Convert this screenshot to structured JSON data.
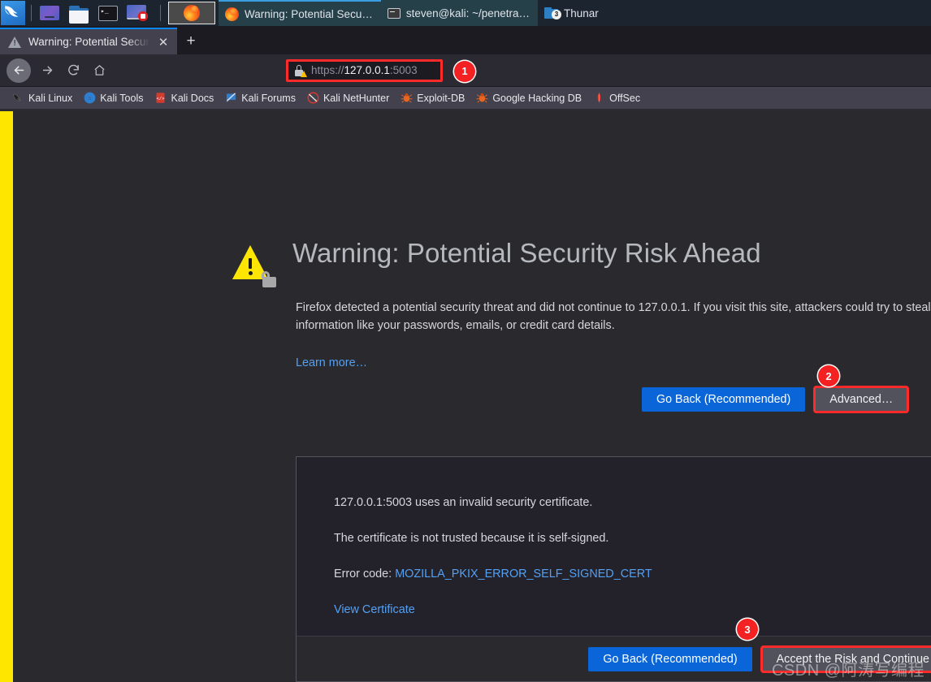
{
  "taskbar": {
    "menu_icon": "kali-dragon-logo",
    "launchers": [
      {
        "name": "web-browser-launcher",
        "icon": "browser-icon"
      },
      {
        "name": "file-manager-launcher",
        "icon": "folder-icon"
      },
      {
        "name": "terminal-launcher",
        "icon": "terminal-icon"
      },
      {
        "name": "screen-recorder-launcher",
        "icon": "record-icon"
      }
    ],
    "active_window_icon": "firefox-icon",
    "tasks": [
      {
        "label": "Warning: Potential Secu…",
        "icon": "firefox-icon",
        "active": true,
        "badge": ""
      },
      {
        "label": "steven@kali: ~/penetra…",
        "icon": "terminal-icon",
        "active": false,
        "badge": ""
      },
      {
        "label": "Thunar",
        "icon": "folder-icon",
        "active": false,
        "badge": "3"
      }
    ]
  },
  "browser": {
    "tab": {
      "title": "Warning: Potential Secur",
      "favicon": "warning-triangle-icon",
      "close_label": "✕"
    },
    "newtab_label": "+",
    "nav": {
      "back_icon": "arrow-left-icon",
      "forward_icon": "arrow-right-icon",
      "reload_icon": "reload-icon",
      "home_icon": "home-icon"
    },
    "url": {
      "scheme": "https://",
      "host": "127.0.0.1",
      "port": ":5003",
      "full": "https://127.0.0.1:5003",
      "identity_icon": "lock-warning-icon"
    },
    "bookmarks": [
      {
        "label": "Kali Linux",
        "icon": "kali-dragon-icon"
      },
      {
        "label": "Kali Tools",
        "icon": "kali-tools-icon"
      },
      {
        "label": "Kali Docs",
        "icon": "kali-docs-icon"
      },
      {
        "label": "Kali Forums",
        "icon": "kali-forums-icon"
      },
      {
        "label": "Kali NetHunter",
        "icon": "kali-nethunter-icon"
      },
      {
        "label": "Exploit-DB",
        "icon": "bug-icon"
      },
      {
        "label": "Google Hacking DB",
        "icon": "bug-icon"
      },
      {
        "label": "OffSec",
        "icon": "offsec-dragon-icon"
      }
    ]
  },
  "page": {
    "heading": "Warning: Potential Security Risk Ahead",
    "heading_icon": "warning-lock-icon",
    "body": "Firefox detected a potential security threat and did not continue to 127.0.0.1. If you visit this site, attackers could try to steal information like your passwords, emails, or credit card details.",
    "learn_more": "Learn more…",
    "go_back_label": "Go Back (Recommended)",
    "advanced_label": "Advanced…",
    "advanced_panel": {
      "line1": "127.0.0.1:5003 uses an invalid security certificate.",
      "line2": "The certificate is not trusted because it is self-signed.",
      "error_prefix": "Error code: ",
      "error_code": "MOZILLA_PKIX_ERROR_SELF_SIGNED_CERT",
      "view_certificate": "View Certificate",
      "go_back_label": "Go Back (Recommended)",
      "accept_label": "Accept the Risk and Continue"
    }
  },
  "annotations": {
    "one": "1",
    "two": "2",
    "three": "3",
    "color": "#f32121"
  },
  "watermark": "CSDN @阿涛写编程",
  "colors": {
    "accent_blue": "#0a66d8",
    "link_blue": "#54a0f2",
    "warning_yellow": "#ffe602",
    "annotation_red": "#ff2b2b",
    "page_bg": "#2a2a2e"
  }
}
